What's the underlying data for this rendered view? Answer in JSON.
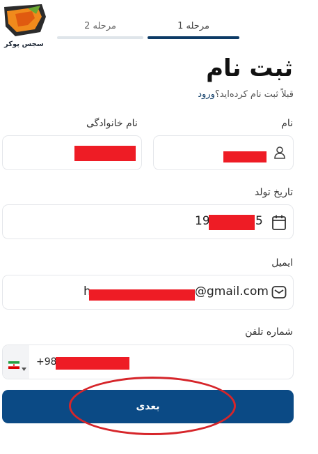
{
  "brand": {
    "name": "سجس پوکر"
  },
  "steps": [
    {
      "label": "مرحله 1",
      "active": true
    },
    {
      "label": "مرحله 2",
      "active": false
    }
  ],
  "header": {
    "title": "ثبت نام",
    "login_prompt": "قبلاً ثبت نام کرده‌اید؟",
    "login_link": "ورود"
  },
  "form": {
    "first_name": {
      "label": "نام"
    },
    "last_name": {
      "label": "نام خانوادگی"
    },
    "birth_date": {
      "label": "تاریخ تولد",
      "visible_prefix": "19",
      "visible_suffix": "5"
    },
    "email": {
      "label": "ایمیل",
      "visible_prefix": "h",
      "visible_suffix": "@gmail.com"
    },
    "phone": {
      "label": "شماره تلفن",
      "country_code": "+98"
    }
  },
  "actions": {
    "next_label": "بعدی"
  },
  "colors": {
    "primary": "#0b4a85",
    "step_active": "#0d3b66",
    "annotation": "#d6252a",
    "redaction": "#ee1c25"
  },
  "icons": {
    "logo": "fox-logo",
    "user": "person-icon",
    "calendar": "calendar-icon",
    "email": "envelope-icon",
    "flag": "iran-flag-icon",
    "dropdown": "caret-down-icon"
  }
}
